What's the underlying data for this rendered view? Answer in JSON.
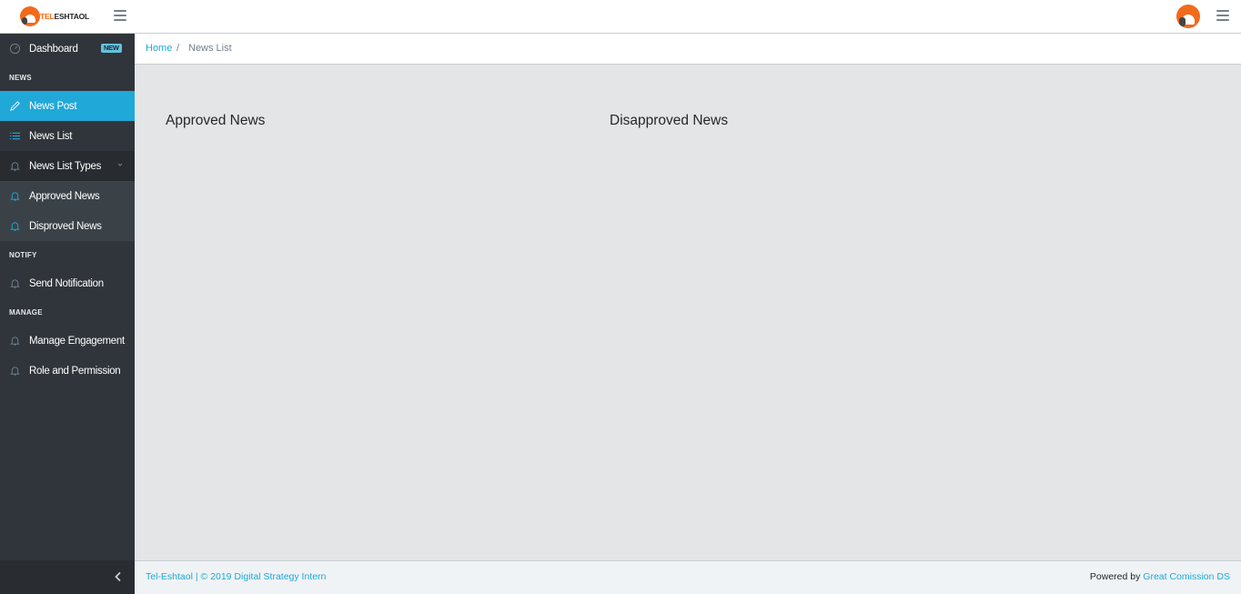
{
  "app": {
    "brand_part1": "TEL",
    "brand_part2": "ESHTAOL"
  },
  "sidebar": {
    "dashboard": {
      "label": "Dashboard",
      "badge": "NEW",
      "icon": "speedometer-icon"
    },
    "sections": {
      "news": "NEWS",
      "notify": "NOTIFY",
      "manage": "MANAGE"
    },
    "items": [
      {
        "label": "News Post",
        "icon": "pencil-icon"
      },
      {
        "label": "News List",
        "icon": "list-icon"
      },
      {
        "label": "News List Types",
        "icon": "bell-icon"
      },
      {
        "label": "Approved News",
        "icon": "bell-icon"
      },
      {
        "label": "Disproved News",
        "icon": "bell-icon"
      },
      {
        "label": "Send Notification",
        "icon": "bell-icon"
      },
      {
        "label": "Manage Engagement",
        "icon": "bell-icon"
      },
      {
        "label": "Role and Permission",
        "icon": "bell-icon"
      }
    ]
  },
  "breadcrumb": {
    "home": "Home",
    "separator": "/",
    "current": "News List"
  },
  "main": {
    "approved_title": "Approved News",
    "disapproved_title": "Disapproved News"
  },
  "footer": {
    "left": "Tel-Eshtaol | © 2019 Digital Strategy Intern",
    "powered_prefix": "Powered by",
    "powered_link": "Great Comission DS"
  },
  "colors": {
    "accent": "#20a8d8",
    "sidebar_bg": "#2f353a",
    "brand_orange": "#f26a1b",
    "badge": "#63c2de"
  }
}
